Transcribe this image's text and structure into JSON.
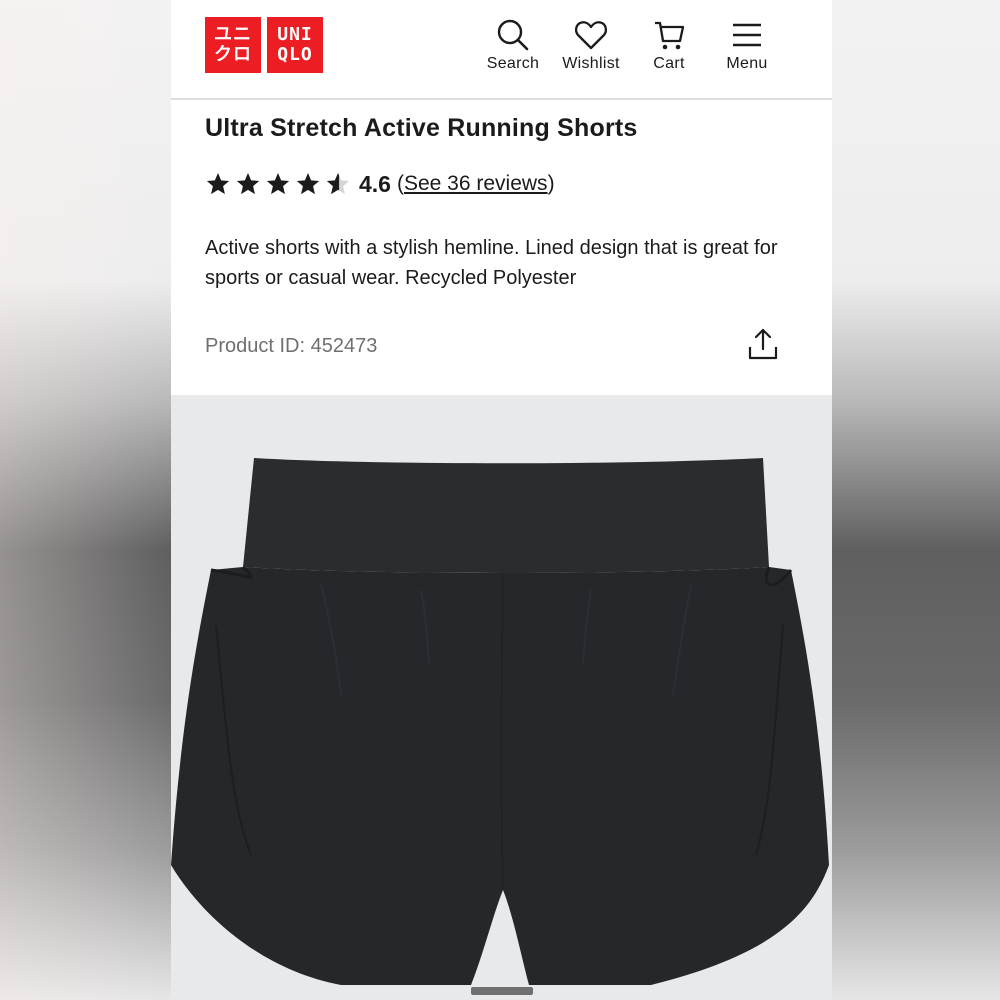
{
  "brand": {
    "logo_left": [
      "ユニ",
      "クロ"
    ],
    "logo_right": [
      "UNI",
      "QLO"
    ],
    "color": "#ed1d24"
  },
  "nav": [
    {
      "label": "Search",
      "icon": "search-icon"
    },
    {
      "label": "Wishlist",
      "icon": "heart-icon"
    },
    {
      "label": "Cart",
      "icon": "cart-icon"
    },
    {
      "label": "Menu",
      "icon": "hamburger-icon"
    }
  ],
  "product": {
    "title": "Ultra Stretch Active Running Shorts",
    "rating": {
      "stars": 4.6,
      "value": "4.6",
      "reviews_link": "See 36 reviews"
    },
    "description": "Active shorts with a stylish hemline. Lined design that is great for sports or casual wear. Recycled Polyester",
    "product_id_label": "Product ID: 452473",
    "share_icon": "share-icon"
  },
  "gallery": {
    "image": "black-running-shorts",
    "background": "#e8e9eb",
    "active_index": 1
  }
}
